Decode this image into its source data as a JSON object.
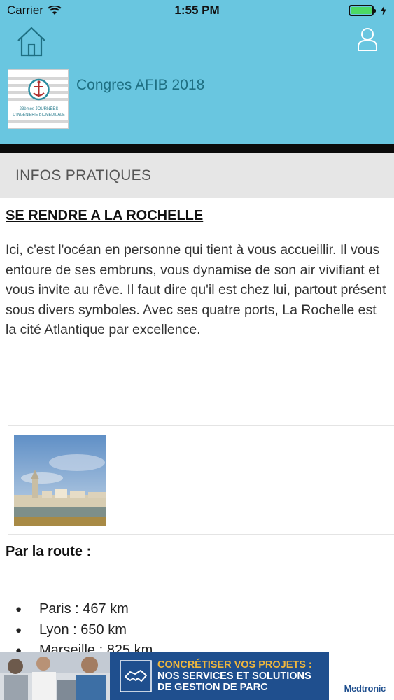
{
  "status_bar": {
    "carrier": "Carrier",
    "time": "1:55 PM",
    "icons": [
      "wifi-icon",
      "battery-icon",
      "charging-icon"
    ]
  },
  "header": {
    "title": "Congres AFIB 2018",
    "logo_text": [
      "23èmes JOURNÉES",
      "D'INGÉNIERIE BIOMÉDICALE"
    ],
    "icons": [
      "home-icon",
      "user-icon"
    ],
    "colors": {
      "header_bg": "#69c6e0",
      "title": "#1e6f82"
    }
  },
  "section": {
    "title": "INFOS PRATIQUES"
  },
  "content": {
    "heading": "SE RENDRE A LA ROCHELLE",
    "intro": "Ici, c'est l'océan en personne qui tient à vous accueillir. Il vous entoure de ses embruns, vous dynamise de son air vivifiant et vous invite au rêve. Il faut dire qu'il est chez lui, partout présent sous divers symboles. Avec ses quatre ports, La Rochelle est la cité Atlantique par excellence.",
    "route_heading": "Par la route :",
    "distances": [
      {
        "city": "Paris : 467 km"
      },
      {
        "city": "Lyon : 650 km"
      },
      {
        "city": "Marseille : 825 km"
      }
    ]
  },
  "ad": {
    "line1": "CONCRÉTISER VOS PROJETS :",
    "line2": "NOS SERVICES ET SOLUTIONS",
    "line3": "DE GESTION DE PARC",
    "brand": "Medtronic",
    "colors": {
      "banner_bg": "#1f4f8e",
      "accent": "#f0b73d"
    }
  }
}
